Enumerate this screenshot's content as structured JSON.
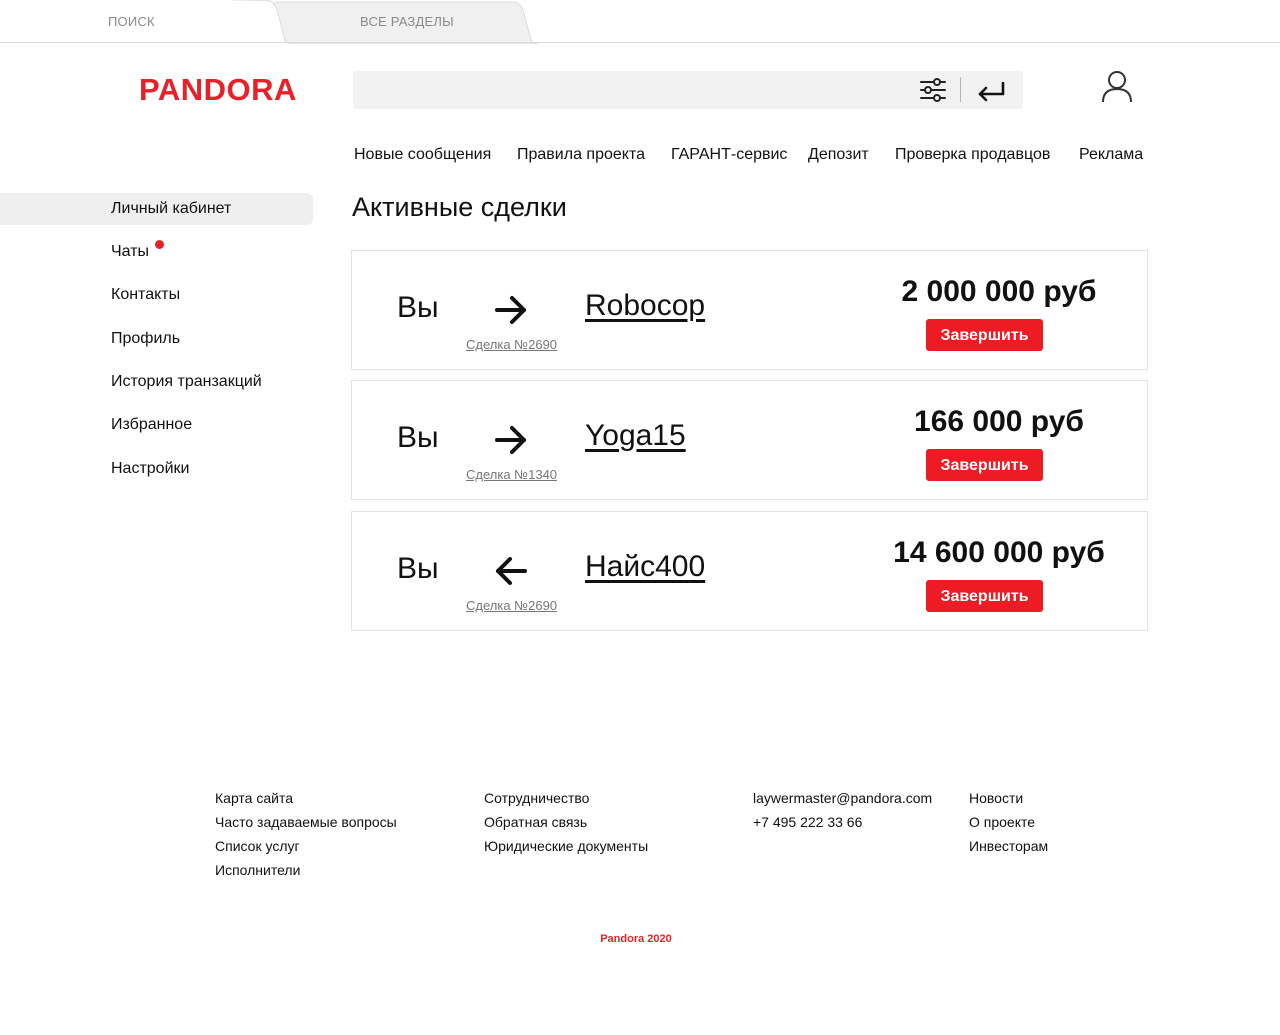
{
  "tabs": {
    "search": "ПОИСК",
    "all_sections": "ВСЕ РАЗДЕЛЫ"
  },
  "header": {
    "logo": "PANDORA",
    "search_placeholder": "",
    "icons": [
      "filter-sliders-icon",
      "enter-arrow-icon",
      "user-icon"
    ]
  },
  "topnav": [
    "Новые сообщения",
    "Правила проекта",
    "ГАРАНТ-сервис",
    "Депозит",
    "Проверка продавцов",
    "Реклама"
  ],
  "sidebar": {
    "items": [
      "Личный кабинет",
      "Чаты",
      "Контакты",
      "Профиль",
      "История транзакций",
      "Избранное",
      "Настройки"
    ],
    "active": "Личный кабинет",
    "unread_dot_on": "Чаты"
  },
  "main": {
    "title": "Активные сделки",
    "deals": [
      {
        "you": "Вы",
        "direction": "outgoing",
        "number": "Сделка №2690",
        "user": "Robocop",
        "amount": "2 000 000 руб",
        "button": "Завершить"
      },
      {
        "you": "Вы",
        "direction": "outgoing",
        "number": "Сделка №1340",
        "user": "Yoga15",
        "amount": "166 000 руб",
        "button": "Завершить"
      },
      {
        "you": "Вы",
        "direction": "incoming",
        "number": "Сделка №2690",
        "user": "Найс400",
        "amount": "14 600 000 руб",
        "button": "Завершить"
      }
    ]
  },
  "footer": {
    "col1": [
      "Карта сайта",
      "Часто задаваемые вопросы",
      "Список услуг",
      "Исполнители"
    ],
    "col2": [
      "Сотрудничество",
      "Обратная связь",
      "Юридические документы"
    ],
    "col3": [
      "laywermaster@pandora.com",
      "+7 495 222 33 66"
    ],
    "col4": [
      "Новости",
      "О проекте",
      "Инвесторам"
    ],
    "copyright": "Pandora 2020"
  },
  "colors": {
    "brand_red": "#e8202a",
    "button_red": "#ed1c24",
    "active_bg": "#efefef"
  }
}
